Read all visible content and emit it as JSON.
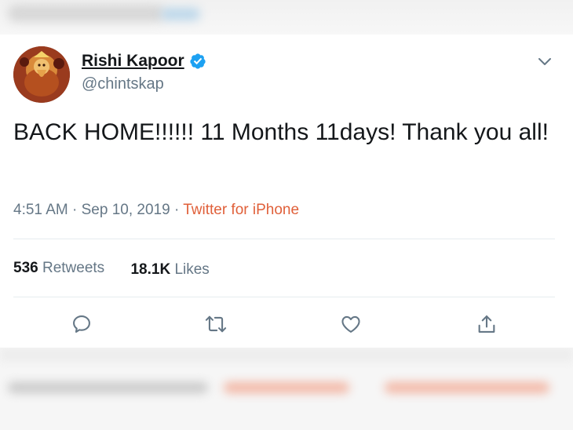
{
  "tweet": {
    "author": {
      "name": "Rishi Kapoor",
      "handle": "@chintskap",
      "verified": true
    },
    "text": "BACK HOME!!!!!! 11 Months 11days! Thank you all!",
    "time": "4:51 AM",
    "separator": "·",
    "date": "Sep 10, 2019",
    "source": "Twitter for iPhone",
    "stats": {
      "retweets_count": "536",
      "retweets_label": "Retweets",
      "likes_count": "18.1K",
      "likes_label": "Likes"
    },
    "actions": [
      "reply-icon",
      "retweet-icon",
      "like-icon",
      "share-icon"
    ]
  },
  "colors": {
    "text": "#14171a",
    "secondary": "#657786",
    "source": "#e0603a",
    "verified": "#1da1f2",
    "divider": "#e6ecf0"
  }
}
